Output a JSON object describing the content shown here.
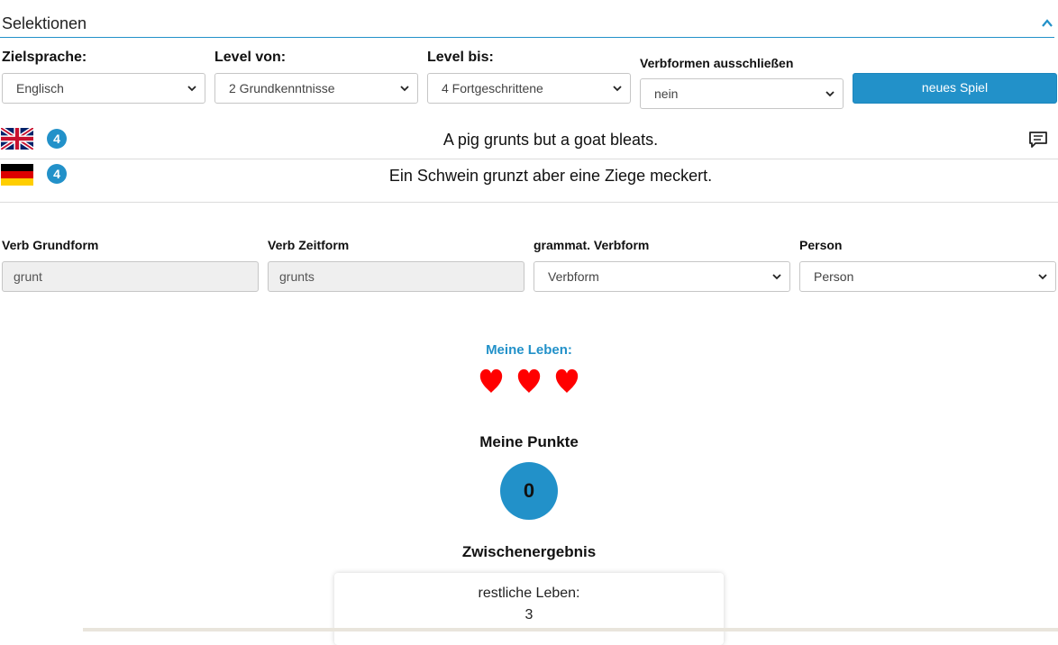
{
  "section": {
    "title": "Selektionen"
  },
  "filters": {
    "target_language": {
      "label": "Zielsprache:",
      "value": "Englisch"
    },
    "level_from": {
      "label": "Level von:",
      "value": "2 Grundkenntnisse"
    },
    "level_to": {
      "label": "Level bis:",
      "value": "4 Fortgeschrittene"
    },
    "exclude_forms": {
      "label": "Verbformen ausschließen",
      "value": "nein"
    },
    "new_game_label": "neues Spiel"
  },
  "sentences": [
    {
      "flag": "uk-flag-icon",
      "level": "4",
      "text": "A pig grunts but a goat bleats."
    },
    {
      "flag": "de-flag-icon",
      "level": "4",
      "text": "Ein Schwein grunzt aber eine Ziege meckert."
    }
  ],
  "verb": {
    "base_label": "Verb Grundform",
    "base_value": "grunt",
    "tense_label": "Verb Zeitform",
    "tense_value": "grunts",
    "form_label": "grammat. Verbform",
    "form_value": "Verbform",
    "person_label": "Person",
    "person_value": "Person"
  },
  "lives": {
    "title": "Meine Leben:",
    "count": 3,
    "color": "#ff0000"
  },
  "score": {
    "title": "Meine Punkte",
    "value": "0"
  },
  "interim": {
    "title": "Zwischenergebnis",
    "remaining_label": "restliche Leben:",
    "remaining_value": "3"
  },
  "colors": {
    "accent": "#2291c9"
  }
}
